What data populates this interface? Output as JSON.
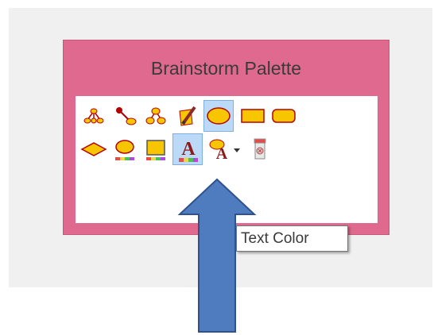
{
  "palette": {
    "title": "Brainstorm Palette",
    "tools": [
      {
        "name": "topic-tree-tool-icon",
        "row": 0
      },
      {
        "name": "link-node-tool-icon",
        "row": 0
      },
      {
        "name": "hierarchy-tool-icon",
        "row": 0
      },
      {
        "name": "note-pencil-tool-icon",
        "row": 0
      },
      {
        "name": "ellipse-shape-tool-icon",
        "row": 0,
        "selected": true
      },
      {
        "name": "rectangle-shape-tool-icon",
        "row": 0
      },
      {
        "name": "rounded-rectangle-shape-tool-icon",
        "row": 0
      },
      {
        "name": "diamond-shape-tool-icon",
        "row": 1
      },
      {
        "name": "fill-color-tool-icon",
        "row": 1
      },
      {
        "name": "line-color-tool-icon",
        "row": 1
      },
      {
        "name": "text-color-tool-icon",
        "row": 1,
        "selected": true
      },
      {
        "name": "text-style-tool-icon",
        "row": 1
      },
      {
        "name": "dropdown-arrow-icon",
        "row": 1
      },
      {
        "name": "delete-tool-icon",
        "row": 1
      }
    ]
  },
  "tooltip": {
    "text": "Text Color"
  },
  "colors": {
    "palette_frame": "#e06a8f",
    "shape_fill": "#f7c600",
    "shape_stroke": "#b50000",
    "selection": "#bcdaf7",
    "arrow": "#4f7bbf"
  }
}
